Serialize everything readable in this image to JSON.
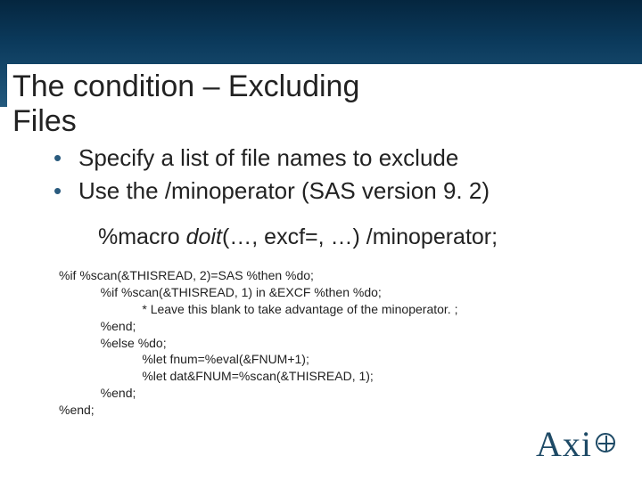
{
  "title": "The condition – Excluding Files",
  "bullets": [
    "Specify a list of file names to exclude",
    "Use the /minoperator  (SAS version 9. 2)"
  ],
  "macro_decl": {
    "prefix": "%macro ",
    "name": "doit",
    "args": "(…, excf=, …) /minoperator;"
  },
  "code": "%if %scan(&THISREAD, 2)=SAS %then %do;\n            %if %scan(&THISREAD, 1) in &EXCF %then %do;\n                        * Leave this blank to take advantage of the minoperator. ;\n            %end;\n            %else %do;\n                        %let fnum=%eval(&FNUM+1);\n                        %let dat&FNUM=%scan(&THISREAD, 1);\n            %end;\n%end;",
  "logo": {
    "part1": "Axi",
    "part2": ""
  }
}
